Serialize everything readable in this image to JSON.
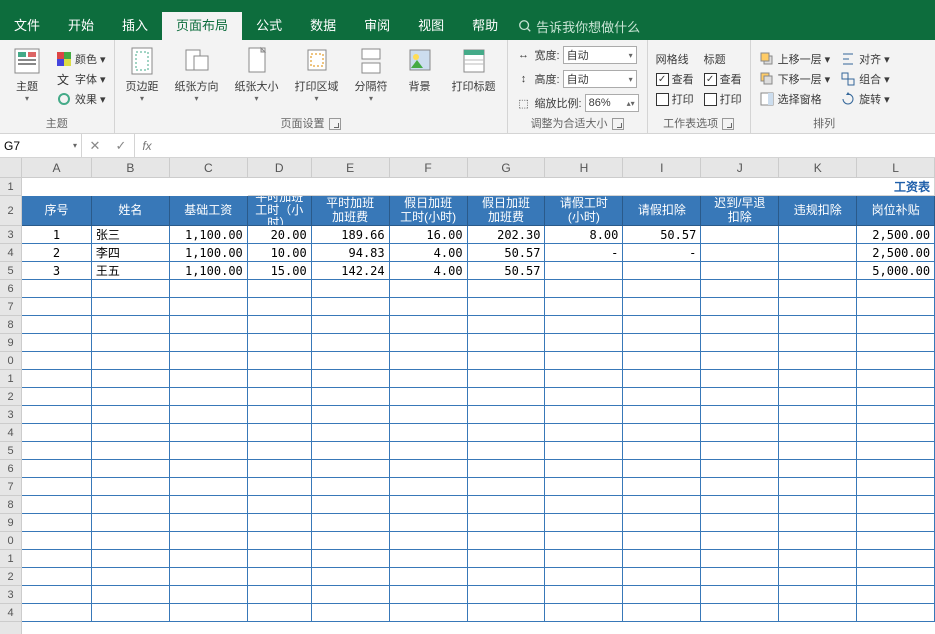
{
  "menubar": {
    "items": [
      "文件",
      "开始",
      "插入",
      "页面布局",
      "公式",
      "数据",
      "审阅",
      "视图",
      "帮助"
    ],
    "active": 3,
    "tell": "告诉我你想做什么"
  },
  "ribbon": {
    "themes": {
      "color": "颜色",
      "font": "字体",
      "effect": "效果",
      "btn": "主题",
      "label": "主题"
    },
    "pagesetup": {
      "margins": "页边距",
      "orient": "纸张方向",
      "size": "纸张大小",
      "area": "打印区域",
      "breaks": "分隔符",
      "bg": "背景",
      "titles": "打印标题",
      "label": "页面设置"
    },
    "scale": {
      "width": "宽度:",
      "height": "高度:",
      "auto": "自动",
      "scale": "缩放比例:",
      "scale_val": "86%",
      "label": "调整为合适大小"
    },
    "sheetopts": {
      "grid": "网格线",
      "head": "标题",
      "view": "查看",
      "print": "打印",
      "label": "工作表选项"
    },
    "arrange": {
      "fwd": "上移一层",
      "bwd": "下移一层",
      "pane": "选择窗格",
      "align": "对齐",
      "group": "组合",
      "rotate": "旋转",
      "label": "排列"
    }
  },
  "formula_bar": {
    "name": "G7"
  },
  "sheet": {
    "rowhdrs": [
      "1",
      "2",
      "3",
      "4",
      "5",
      "6",
      "7",
      "8",
      "9",
      "0",
      "1",
      "2",
      "3",
      "4",
      "5",
      "6",
      "7",
      "8",
      "9",
      "0",
      "1",
      "2",
      "3",
      "4"
    ],
    "cols": [
      "A",
      "B",
      "C",
      "D",
      "E",
      "F",
      "G",
      "H",
      "I",
      "J",
      "K",
      "L"
    ],
    "title": "工资表",
    "headers": [
      "序号",
      "姓名",
      "基础工资",
      "平时加班\n工时（小\n时）",
      "平时加班\n加班费",
      "假日加班\n工时(小时)",
      "假日加班\n加班费",
      "请假工时\n(小时)",
      "请假扣除",
      "迟到/早退\n扣除",
      "违规扣除",
      "岗位补贴"
    ],
    "rows": [
      [
        "1",
        "张三",
        "1,100.00",
        "20.00",
        "189.66",
        "16.00",
        "202.30",
        "8.00",
        "50.57",
        "",
        "",
        "2,500.00"
      ],
      [
        "2",
        "李四",
        "1,100.00",
        "10.00",
        "94.83",
        "4.00",
        "50.57",
        "-",
        "-",
        "",
        "",
        "2,500.00"
      ],
      [
        "3",
        "王五",
        "1,100.00",
        "15.00",
        "142.24",
        "4.00",
        "50.57",
        "",
        "",
        "",
        "",
        "5,000.00"
      ]
    ]
  }
}
